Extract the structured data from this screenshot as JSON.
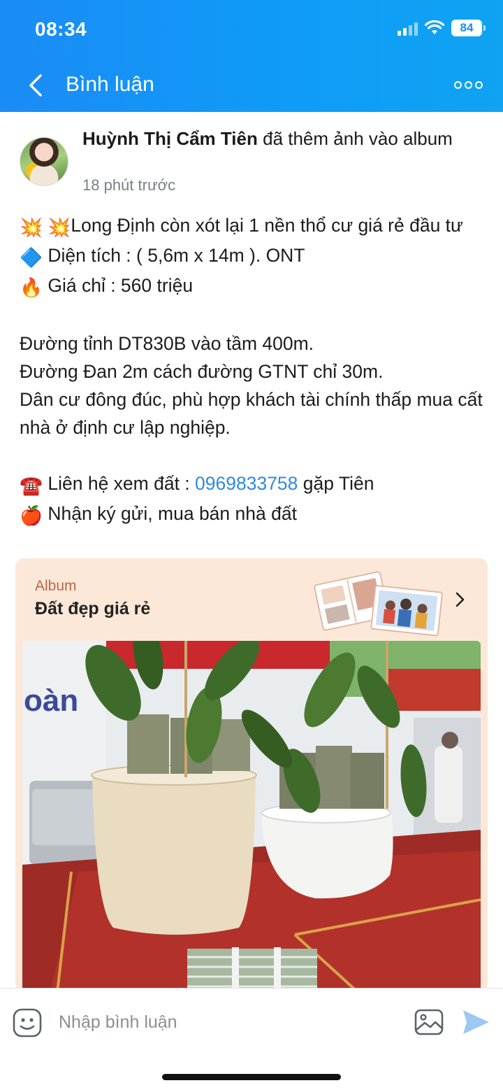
{
  "status_bar": {
    "time": "08:34",
    "battery": "84"
  },
  "header": {
    "title": "Bình luận"
  },
  "post": {
    "author": "Huỳnh Thị Cẩm Tiên",
    "action": "đã thêm ảnh vào album",
    "time": "18 phút trước",
    "lines": [
      {
        "emoji": "💥 💥",
        "text": "Long Định còn xót lại 1 nền thổ cư giá rẻ đầu tư"
      },
      {
        "emoji": "🔷",
        "text": " Diện tích : ( 5,6m x 14m ). ONT"
      },
      {
        "emoji": "🔥",
        "text": " Giá chỉ : 560 triệu"
      },
      {
        "text": ""
      },
      {
        "text": "Đường tỉnh DT830B vào tầm 400m."
      },
      {
        "text": "Đường Đan 2m cách đường GTNT chỉ 30m."
      },
      {
        "text": "Dân cư đông đúc, phù hợp khách tài chính thấp mua cất nhà ở định cư lập nghiệp."
      },
      {
        "text": ""
      }
    ],
    "contact": {
      "emoji": "☎️",
      "prefix": " Liên hệ xem đất : ",
      "phone": "0969833758",
      "suffix": " gặp Tiên"
    },
    "consign": {
      "emoji": "🍎",
      "text": " Nhận ký gửi, mua bán nhà đất"
    }
  },
  "album": {
    "label": "Album",
    "name": "Đất đẹp giá rẻ"
  },
  "comment_box": {
    "placeholder": "Nhập bình luận"
  },
  "colors": {
    "header": "#1a8cf5",
    "link": "#2f8ae0",
    "album_bg": "#fce8d9",
    "send": "#9cc8f2"
  }
}
